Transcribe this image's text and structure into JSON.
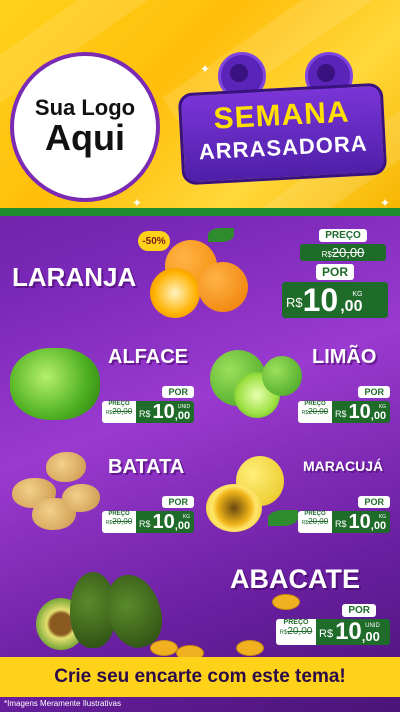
{
  "logo": {
    "line1": "Sua Logo",
    "line2": "Aqui"
  },
  "banner": {
    "line1": "SEMANA",
    "line2": "ARRASADORA"
  },
  "products": {
    "laranja": {
      "name": "LARANJA",
      "discount": "-50%",
      "preco_label": "PREÇO",
      "old_prefix": "R$",
      "old_price": "20,00",
      "por_label": "POR",
      "currency": "R$",
      "price_int": "10",
      "price_dec": ",00",
      "unit": "KG"
    },
    "alface": {
      "name": "ALFACE",
      "preco_label": "PREÇO",
      "old_prefix": "R$",
      "old_price": "20,00",
      "por_label": "POR",
      "currency": "R$",
      "price_int": "10",
      "price_dec": ",00",
      "unit": "UNID"
    },
    "limao": {
      "name": "LIMÃO",
      "preco_label": "PREÇO",
      "old_prefix": "R$",
      "old_price": "20,00",
      "por_label": "POR",
      "currency": "R$",
      "price_int": "10",
      "price_dec": ",00",
      "unit": "KG"
    },
    "batata": {
      "name": "BATATA",
      "preco_label": "PREÇO",
      "old_prefix": "R$",
      "old_price": "20,00",
      "por_label": "POR",
      "currency": "R$",
      "price_int": "10",
      "price_dec": ",00",
      "unit": "KG"
    },
    "maracuja": {
      "name": "MARACUJÁ",
      "preco_label": "PREÇO",
      "old_prefix": "R$",
      "old_price": "20,00",
      "por_label": "POR",
      "currency": "R$",
      "price_int": "10",
      "price_dec": ",00",
      "unit": "KG"
    },
    "abacate": {
      "name": "ABACATE",
      "preco_label": "PREÇO",
      "old_prefix": "R$",
      "old_price": "20,00",
      "por_label": "POR",
      "currency": "R$",
      "price_int": "10",
      "price_dec": ",00",
      "unit": "UNID"
    }
  },
  "footer": {
    "cta": "Crie seu encarte com este tema!",
    "note": "*Imagens Meramente Ilustrativas"
  },
  "colors": {
    "yellow": "#ffd21a",
    "purple": "#7a28b8",
    "green": "#1f6b2a"
  }
}
